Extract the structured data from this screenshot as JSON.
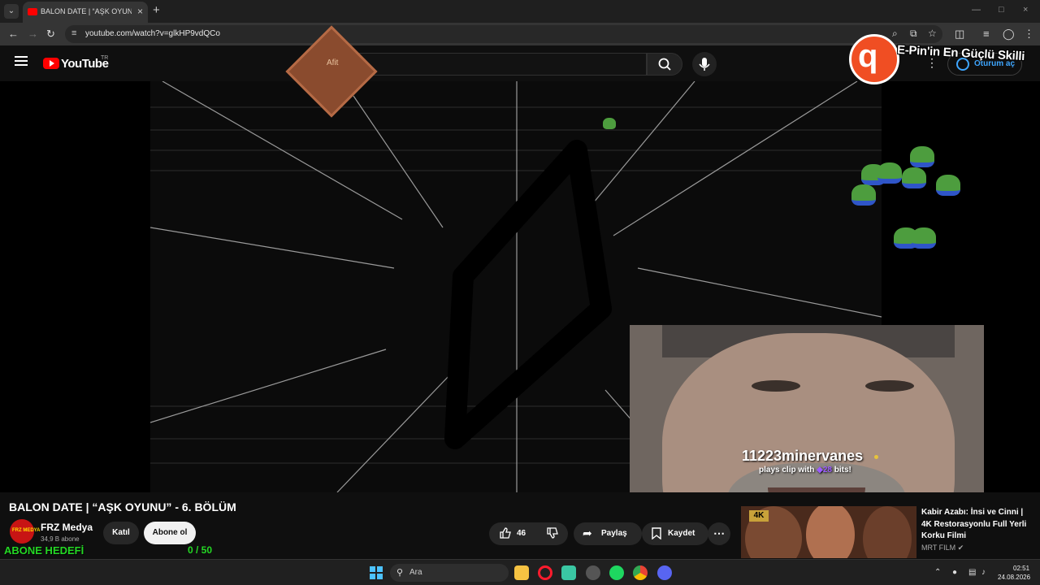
{
  "browser": {
    "tab_title": "BALON DATE | “AŞK OYUNU” - 6. BÖLÜM",
    "url": "youtube.com/watch?v=glkHP9vdQCo"
  },
  "youtube": {
    "logo_text": "YouTube",
    "region": "TR",
    "signin_label": "Oturum aç"
  },
  "overlay": {
    "streamer_logo": "q",
    "banner_text": "E-Pin'in En Güçlü Skilli",
    "diamond_text": "Afit"
  },
  "clip": {
    "username": "11223minervanes",
    "subtitle_prefix": "plays clip with",
    "bits": "28",
    "subtitle_suffix": "bits!"
  },
  "video": {
    "title": "BALON DATE | “AŞK OYUNU” - 6. BÖLÜM",
    "channel_name": "FRZ Medya",
    "channel_avatar_text": "FRZ MEDYA",
    "subscribers": "34,9 B abone",
    "join_label": "Katıl",
    "subscribe_label": "Abone ol",
    "likes": "46",
    "share_label": "Paylaş",
    "save_label": "Kaydet",
    "more_label": "⋯"
  },
  "sub_goal": {
    "label": "ABONE HEDEFİ",
    "count": "0 / 50",
    "progress": 0
  },
  "recommendation": {
    "badge": "4K",
    "title": "Kabir Azabı: İnsi ve Cinni | 4K Restorasyonlu Full Yerli Korku Filmi",
    "channel": "MRT FILM"
  },
  "taskbar": {
    "search_label": "Ara",
    "time": "02:51",
    "date": "24.08.2026"
  },
  "colors": {
    "accent_green": "#24d824",
    "youtube_red": "#ff0000",
    "link_blue": "#3ea6ff"
  }
}
